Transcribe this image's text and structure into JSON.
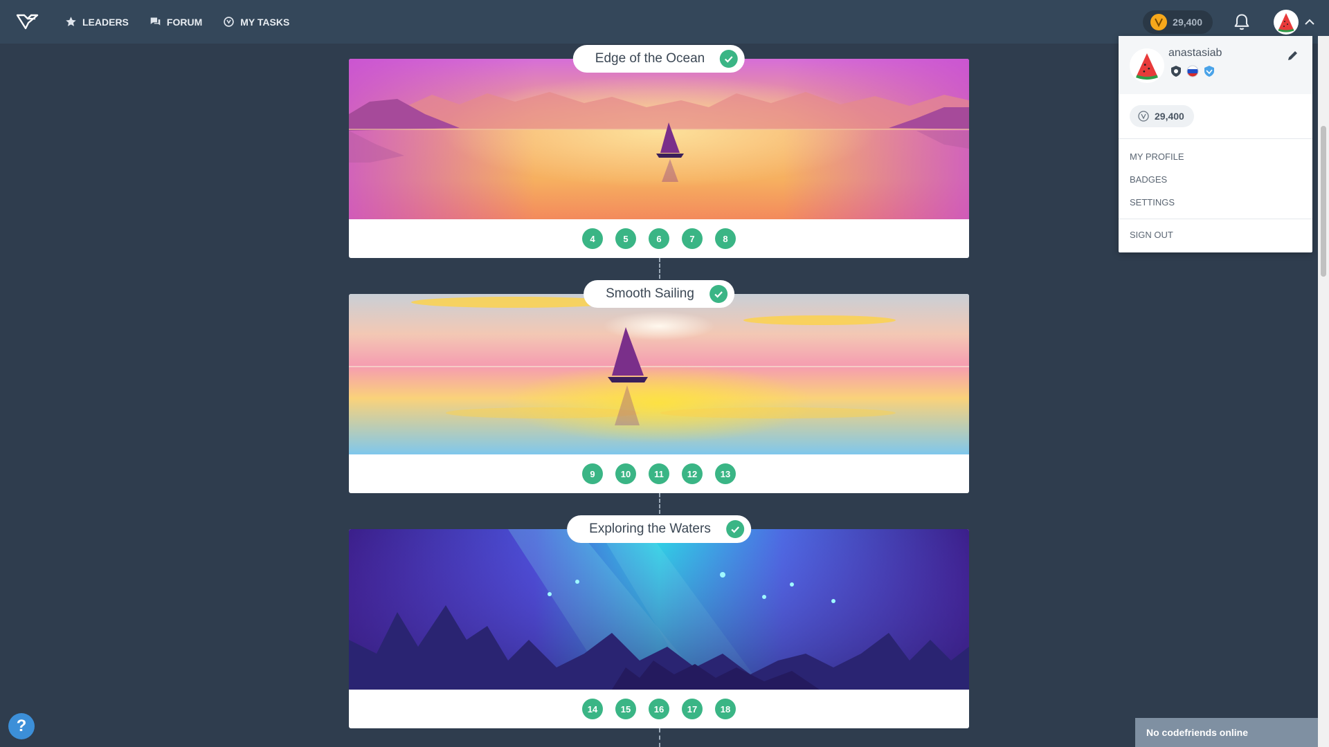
{
  "nav": {
    "items": [
      {
        "label": "LEADERS",
        "icon": "star-icon"
      },
      {
        "label": "FORUM",
        "icon": "forum-icon"
      },
      {
        "label": "MY TASKS",
        "icon": "tasks-icon"
      }
    ]
  },
  "header": {
    "balance": "29,400"
  },
  "levels": [
    {
      "title": "Edge of the Ocean",
      "completed": true,
      "steps": [
        "4",
        "5",
        "6",
        "7",
        "8"
      ]
    },
    {
      "title": "Smooth Sailing",
      "completed": true,
      "steps": [
        "9",
        "10",
        "11",
        "12",
        "13"
      ]
    },
    {
      "title": "Exploring the Waters",
      "completed": true,
      "steps": [
        "14",
        "15",
        "16",
        "17",
        "18"
      ]
    }
  ],
  "profile_menu": {
    "username": "anastasiab",
    "balance": "29,400",
    "items": [
      "MY PROFILE",
      "BADGES",
      "SETTINGS"
    ],
    "sign_out": "SIGN OUT"
  },
  "footer": {
    "help": "?",
    "friends_status": "No codefriends online"
  },
  "colors": {
    "background": "#2f3d4e",
    "topbar": "#34475a",
    "accent_green": "#3ab585",
    "coin": "#f7a81b"
  }
}
